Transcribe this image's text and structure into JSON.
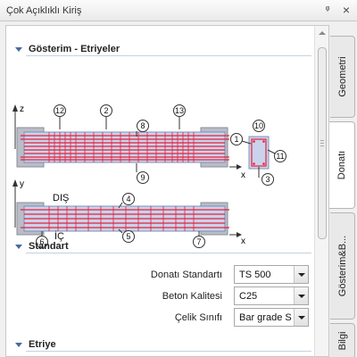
{
  "window": {
    "title": "Çok Açıklıklı Kiriş",
    "pin_symbol": "ᵠ",
    "close_symbol": "×"
  },
  "sections": {
    "gosterim": {
      "title": "Gösterim - Etriyeler"
    },
    "standart": {
      "title": "Standart"
    },
    "etriye": {
      "title": "Etriye"
    }
  },
  "diagram": {
    "top_view": {
      "axis_z": "z",
      "axis_x": "x",
      "callouts": [
        "12",
        "2",
        "13",
        "8",
        "9"
      ]
    },
    "section_view": {
      "callouts": [
        "10",
        "1",
        "11",
        "3"
      ],
      "axis_x": "x"
    },
    "plan_view": {
      "axis_y": "y",
      "axis_x": "x",
      "label_outside": "DIŞ",
      "label_inside": "İÇ",
      "callouts": [
        "4",
        "5",
        "6",
        "7"
      ]
    },
    "rebar_color": "#e8203a"
  },
  "standart_form": {
    "fields": [
      {
        "label": "Donatı Standartı",
        "value": "TS 500"
      },
      {
        "label": "Beton Kalitesi",
        "value": "C25"
      },
      {
        "label": "Çelik Sınıfı",
        "value": "Bar grade S"
      }
    ]
  },
  "tabs": [
    {
      "label": "Geometri",
      "active": false
    },
    {
      "label": "Donatı",
      "active": true
    },
    {
      "label": "Gösterim&B...",
      "active": false
    },
    {
      "label": "Bilgi",
      "active": false
    }
  ]
}
